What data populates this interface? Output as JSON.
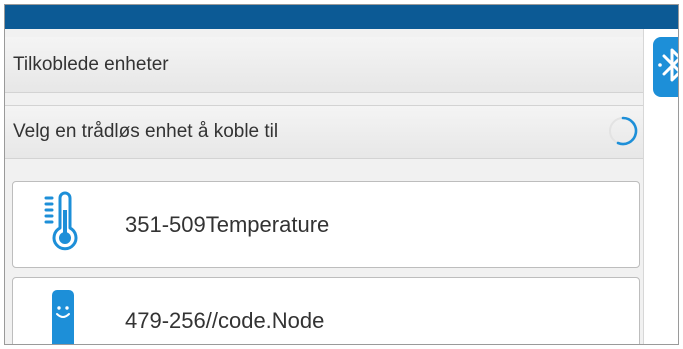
{
  "colors": {
    "header_bar": "#0c5a95",
    "accent": "#1d8fd8",
    "text": "#333333"
  },
  "connected_section": {
    "title": "Tilkoblede enheter"
  },
  "available_section": {
    "title": "Velg en trådløs enhet å koble til",
    "status": "searching"
  },
  "devices": [
    {
      "id": "351-509",
      "name": "Temperature",
      "icon": "thermometer-icon"
    },
    {
      "id": "479-256",
      "name": "//code.Node",
      "icon": "code-node-icon"
    }
  ],
  "sidebar": {
    "icon": "bluetooth-icon"
  }
}
